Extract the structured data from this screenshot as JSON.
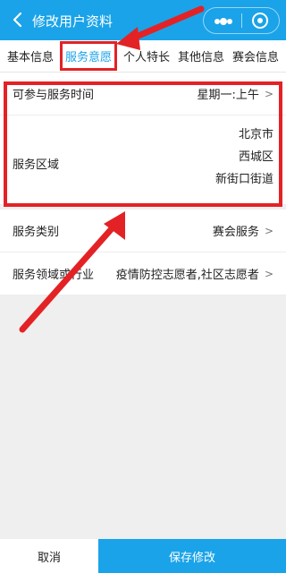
{
  "header": {
    "title": "修改用户资料"
  },
  "tabs": [
    {
      "label": "基本信息"
    },
    {
      "label": "服务意愿"
    },
    {
      "label": "个人特长"
    },
    {
      "label": "其他信息"
    },
    {
      "label": "赛会信息"
    }
  ],
  "form": {
    "service_time": {
      "label": "可参与服务时间",
      "value": "星期一:上午"
    },
    "service_area": {
      "label": "服务区域",
      "values": [
        "北京市",
        "西城区",
        "新街口街道"
      ]
    },
    "service_category": {
      "label": "服务类别",
      "value": "赛会服务"
    },
    "service_field": {
      "label": "服务领域或行业",
      "value": "疫情防控志愿者,社区志愿者"
    }
  },
  "footer": {
    "cancel": "取消",
    "save": "保存修改"
  },
  "colors": {
    "accent": "#1aa3e8",
    "highlight": "#e32226"
  }
}
